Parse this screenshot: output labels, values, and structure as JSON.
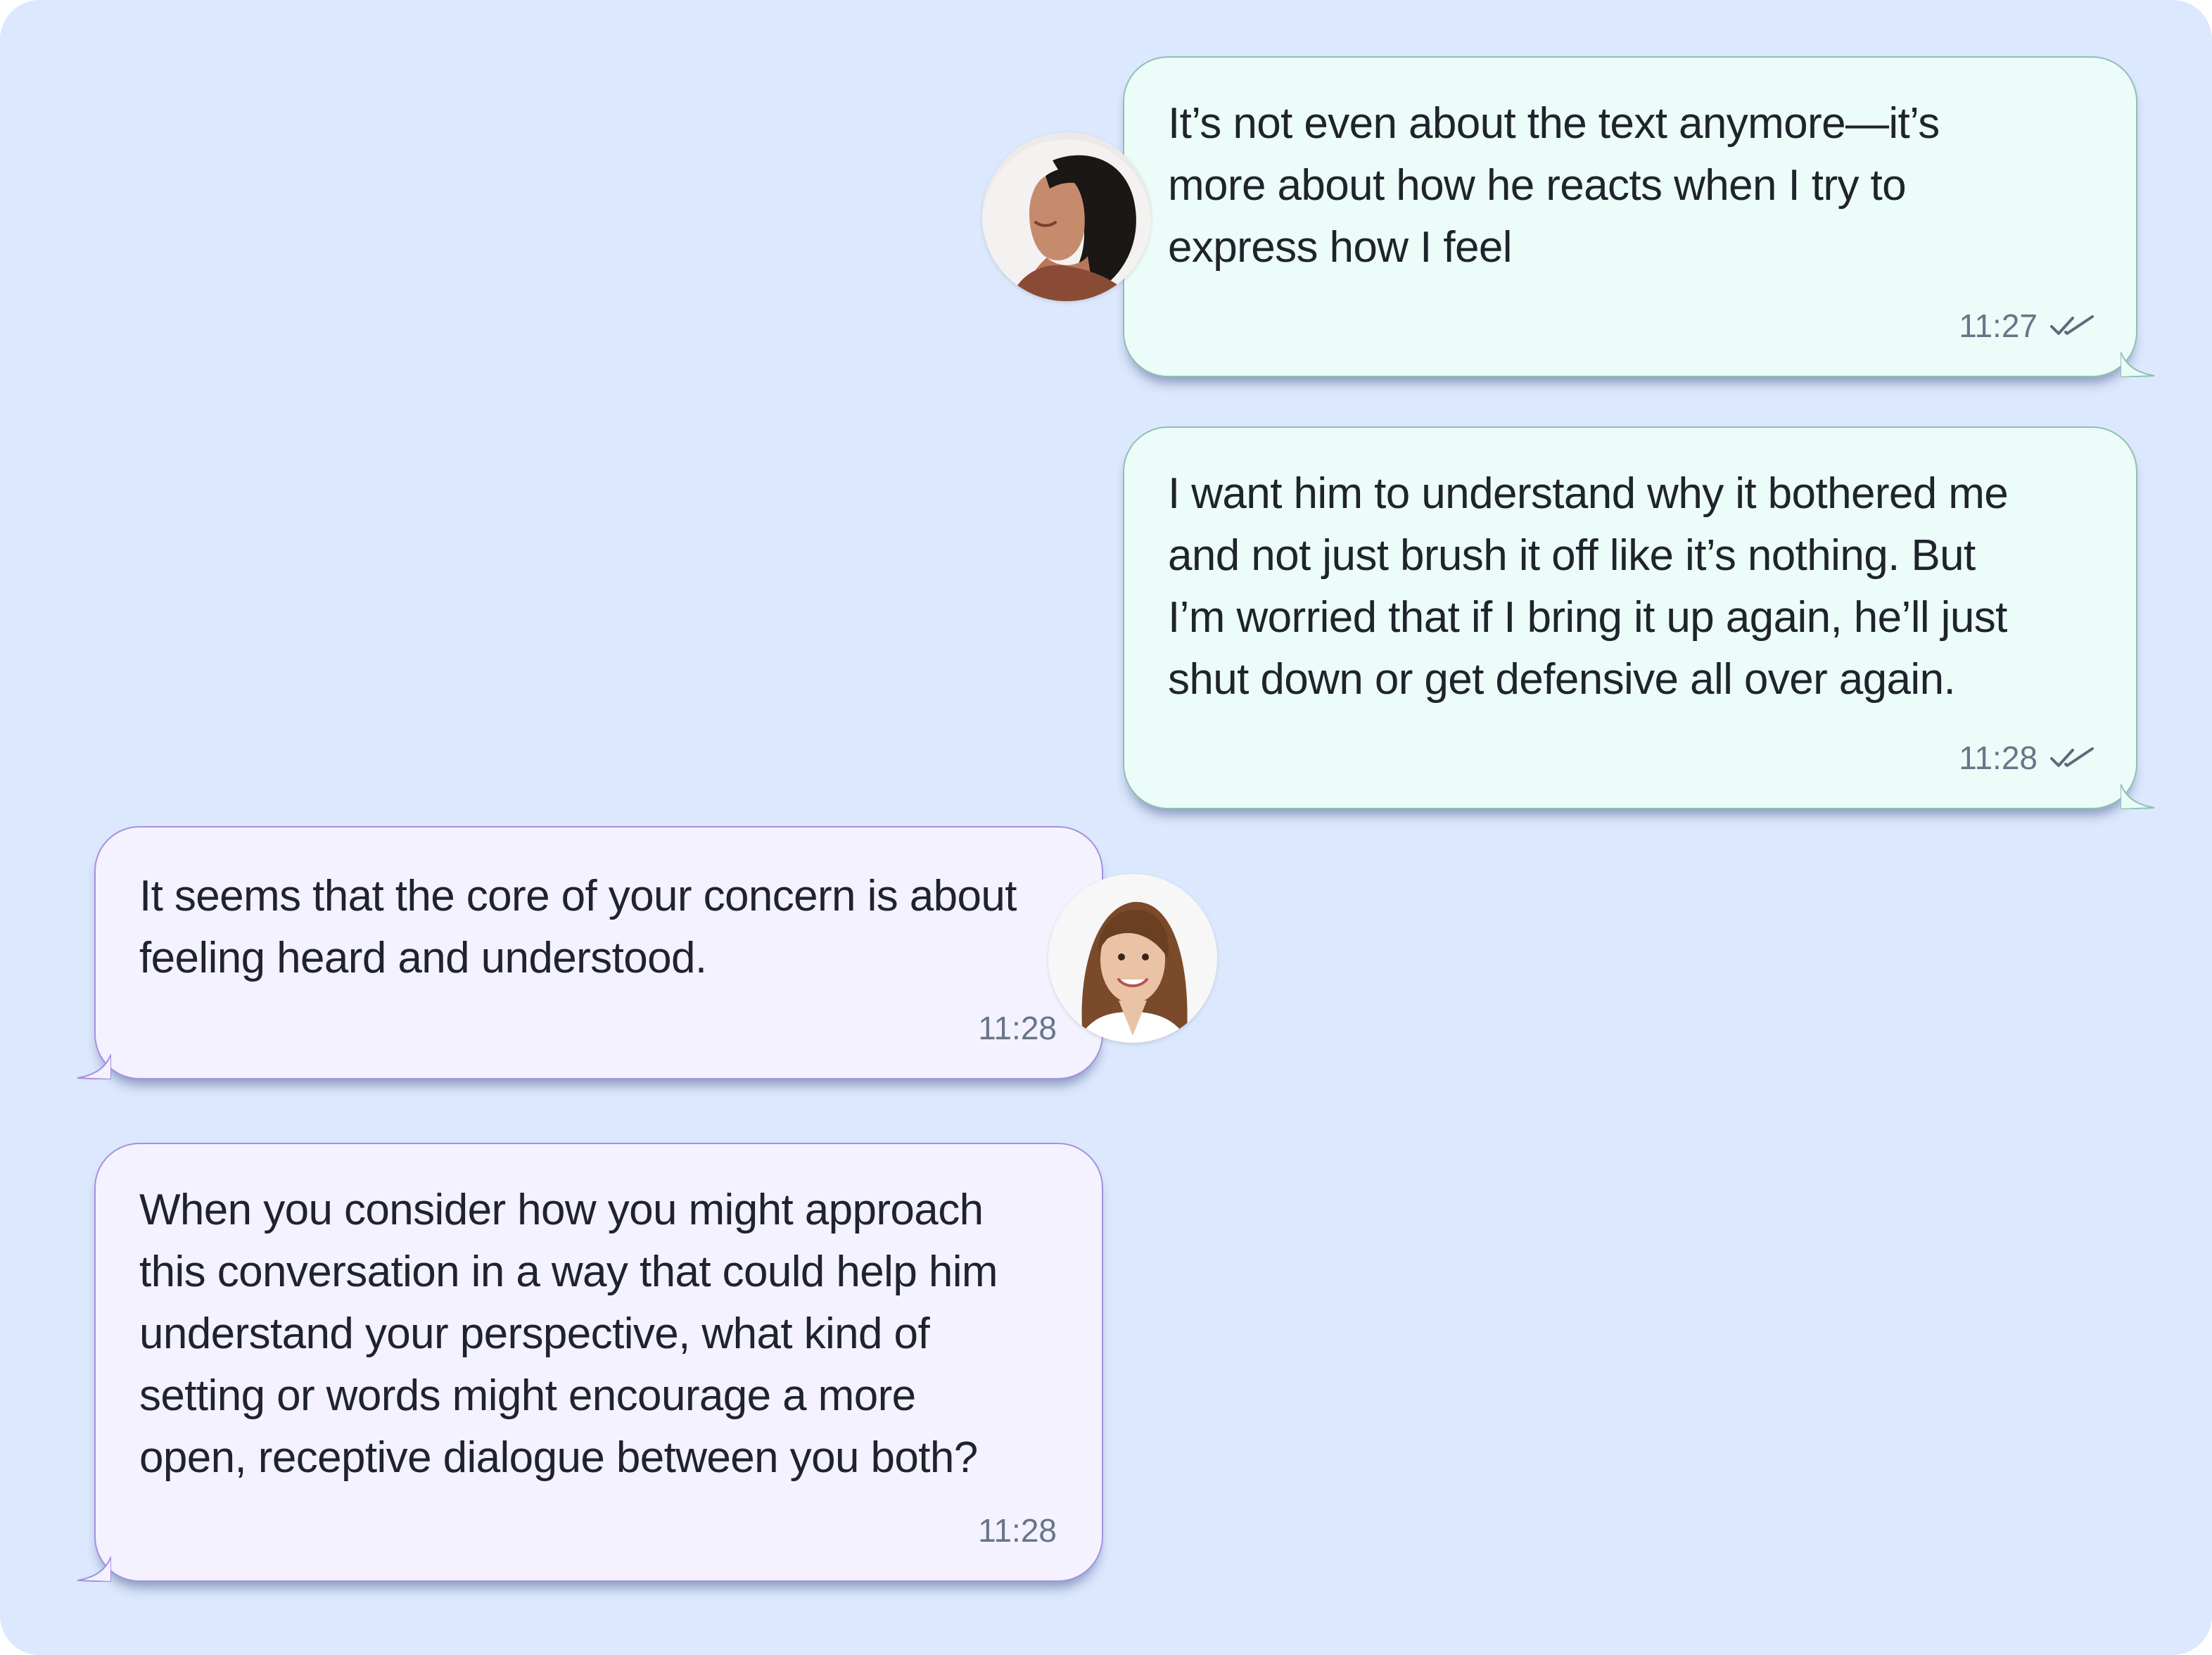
{
  "chat": {
    "messages": [
      {
        "direction": "outgoing",
        "lines": [
          "It’s not even about the text anymore—it’s",
          "more about how he reacts when I try to",
          "express how I feel"
        ],
        "time": "11:27",
        "status_icon": "double-check-icon"
      },
      {
        "direction": "outgoing",
        "lines": [
          "I want him to understand why it bothered me",
          "and not just brush it off like it’s nothing. But",
          "I’m worried that if I bring it up again, he’ll just",
          "shut down or get defensive all over again."
        ],
        "time": "11:28",
        "status_icon": "double-check-icon"
      },
      {
        "direction": "incoming",
        "lines": [
          "It seems that the core of your concern is about",
          "feeling heard and understood."
        ],
        "time": "11:28"
      },
      {
        "direction": "incoming",
        "lines": [
          "When you consider how you might approach",
          "this conversation in a way that could help him",
          "understand your perspective, what kind of",
          "setting or words might encourage a more",
          "open, receptive dialogue between you both?"
        ],
        "time": "11:28"
      }
    ]
  },
  "avatars": {
    "user": "user-avatar",
    "assistant": "assistant-avatar"
  },
  "colors": {
    "background": "#dbe8fd",
    "outgoing_bubble": "#ecfcf8",
    "outgoing_border": "#8fbfb6",
    "incoming_bubble": "#f3f2fe",
    "incoming_border": "#a78fe0",
    "text": "#1f232b",
    "meta": "#687588"
  }
}
